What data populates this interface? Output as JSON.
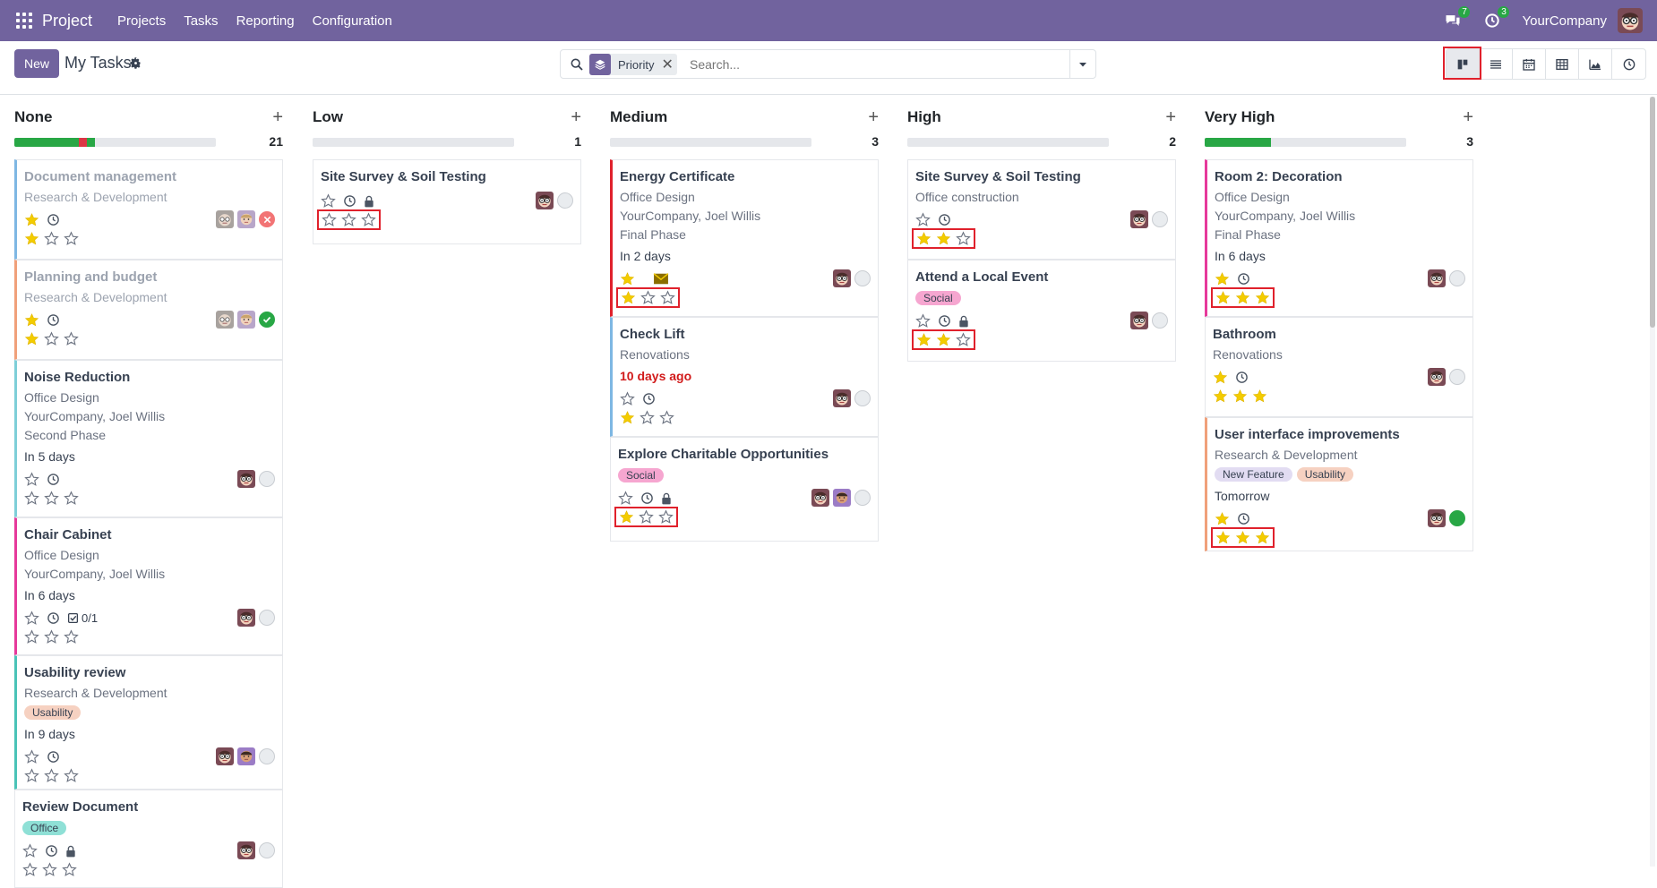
{
  "navbar": {
    "brand": "Project",
    "menu": [
      "Projects",
      "Tasks",
      "Reporting",
      "Configuration"
    ],
    "messages_count": "7",
    "activities_count": "3",
    "company": "YourCompany"
  },
  "control": {
    "new_label": "New",
    "title": "My Tasks",
    "facet": "Priority",
    "search_placeholder": "Search..."
  },
  "colors": {
    "brand": "#71639e",
    "star": "#f3cc00",
    "danger": "#d11a1a",
    "success": "#28a745"
  },
  "columns": [
    {
      "name": "None",
      "count": "21",
      "progress": [
        {
          "color": "#28a745",
          "frac": 0.32
        },
        {
          "color": "#dc3545",
          "frac": 0.04
        },
        {
          "color": "#28a745",
          "frac": 0.04
        }
      ]
    },
    {
      "name": "Low",
      "count": "1",
      "progress": []
    },
    {
      "name": "Medium",
      "count": "3",
      "progress": []
    },
    {
      "name": "High",
      "count": "2",
      "progress": []
    },
    {
      "name": "Very High",
      "count": "3",
      "progress": [
        {
          "color": "#28a745",
          "frac": 0.33
        }
      ]
    }
  ],
  "cards": {
    "none": [
      {
        "title": "Document management",
        "project": "Research & Development",
        "priority": 1,
        "state": "blocked"
      },
      {
        "title": "Planning and budget",
        "project": "Research & Development",
        "priority": 1,
        "state": "done"
      },
      {
        "title": "Noise Reduction",
        "project": "Office Design",
        "customer": "YourCompany, Joel Willis",
        "stage": "Second Phase",
        "deadline": "In 5 days",
        "priority": 0,
        "state": "normal"
      },
      {
        "title": "Chair Cabinet",
        "project": "Office Design",
        "customer": "YourCompany, Joel Willis",
        "deadline": "In 6 days",
        "subtasks": "0/1",
        "priority": 0,
        "state": "normal"
      },
      {
        "title": "Usability review",
        "project": "Research & Development",
        "tags": [
          "Usability"
        ],
        "deadline": "In 9 days",
        "priority": 0,
        "state": "normal"
      },
      {
        "title": "Review Document",
        "tags": [
          "Office"
        ],
        "priority": 0,
        "state": "normal"
      }
    ],
    "low": [
      {
        "title": "Site Survey & Soil Testing",
        "priority": 0,
        "state": "normal"
      }
    ],
    "medium": [
      {
        "title": "Energy Certificate",
        "project": "Office Design",
        "customer": "YourCompany, Joel Willis",
        "stage": "Final Phase",
        "deadline": "In 2 days",
        "priority": 1,
        "state": "normal"
      },
      {
        "title": "Check Lift",
        "project": "Renovations",
        "deadline": "10 days ago",
        "priority": 1,
        "state": "normal"
      },
      {
        "title": "Explore Charitable Opportunities",
        "tags": [
          "Social"
        ],
        "priority": 1,
        "state": "normal"
      }
    ],
    "high": [
      {
        "title": "Site Survey & Soil Testing",
        "project": "Office construction",
        "priority": 2,
        "state": "normal"
      },
      {
        "title": "Attend a Local Event",
        "tags": [
          "Social"
        ],
        "priority": 2,
        "state": "normal"
      }
    ],
    "very_high": [
      {
        "title": "Room 2: Decoration",
        "project": "Office Design",
        "customer": "YourCompany, Joel Willis",
        "stage": "Final Phase",
        "deadline": "In 6 days",
        "priority": 3,
        "state": "normal"
      },
      {
        "title": "Bathroom",
        "project": "Renovations",
        "priority": 3,
        "state": "normal"
      },
      {
        "title": "User interface improvements",
        "project": "Research & Development",
        "tags": [
          "New Feature",
          "Usability"
        ],
        "deadline": "Tomorrow",
        "priority": 3,
        "state": "green"
      }
    ]
  }
}
